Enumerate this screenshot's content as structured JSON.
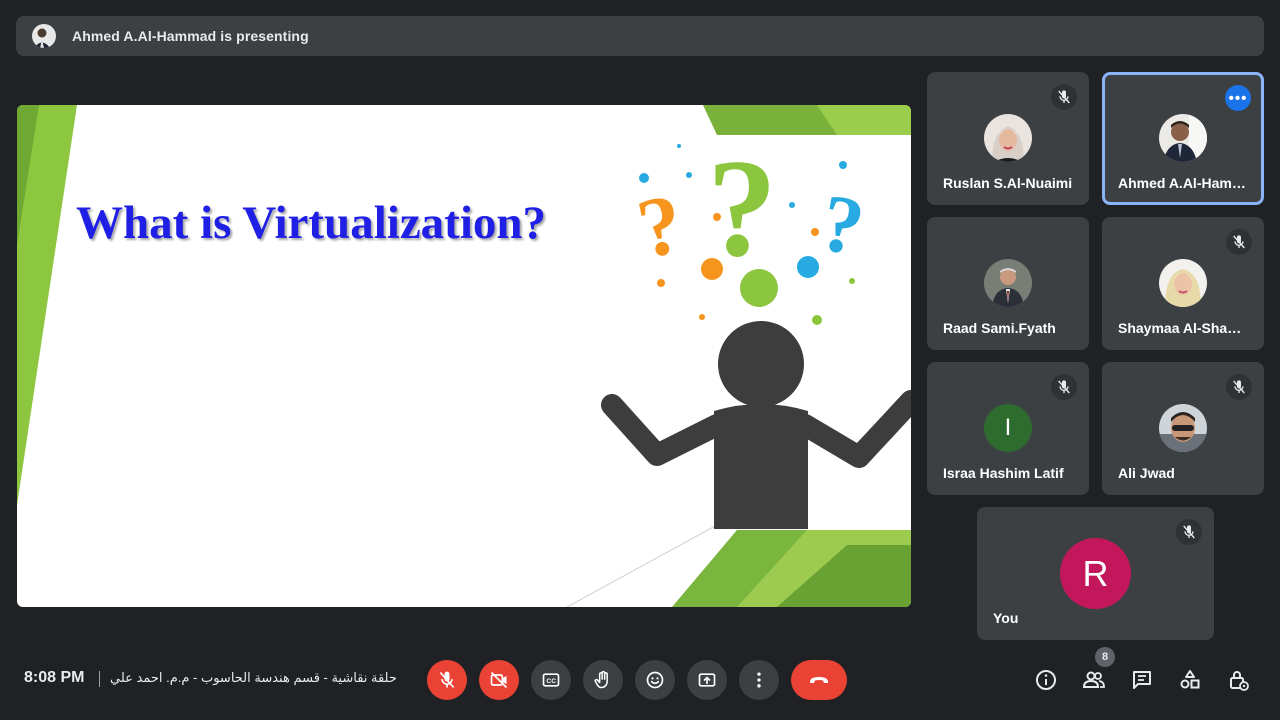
{
  "banner": {
    "text": "Ahmed A.Al-Hammad is presenting"
  },
  "slide": {
    "title": "What is Virtualization?"
  },
  "participants": [
    {
      "name": "Ruslan S.Al-Nuaimi",
      "muted": true
    },
    {
      "name": "Ahmed A.Al-Hammad",
      "presenting": true
    },
    {
      "name": "Raad Sami.Fyath",
      "muted": false
    },
    {
      "name": "Shaymaa Al-Shamary",
      "muted": true
    },
    {
      "name": "Israa Hashim Latif",
      "initial": "I",
      "muted": true
    },
    {
      "name": "Ali Jwad",
      "muted": true
    }
  ],
  "self": {
    "name": "You",
    "initial": "R",
    "muted": true
  },
  "footer": {
    "time": "8:08 PM",
    "meeting_title": "حلقة نقاشية - قسم هندسة الحاسوب - م.م. احمد علي",
    "participant_count": "8"
  },
  "colors": {
    "end_call": "#ea4335",
    "active_tile": "#8ab4f8",
    "self_avatar": "#c2185b",
    "title_blue": "#1f1fe6"
  },
  "icons": [
    "mic-off-icon",
    "camera-off-icon",
    "captions-icon",
    "raise-hand-icon",
    "emoji-icon",
    "present-icon",
    "more-vert-icon",
    "end-call-icon",
    "info-icon",
    "people-icon",
    "chat-icon",
    "activities-icon",
    "host-controls-icon"
  ]
}
